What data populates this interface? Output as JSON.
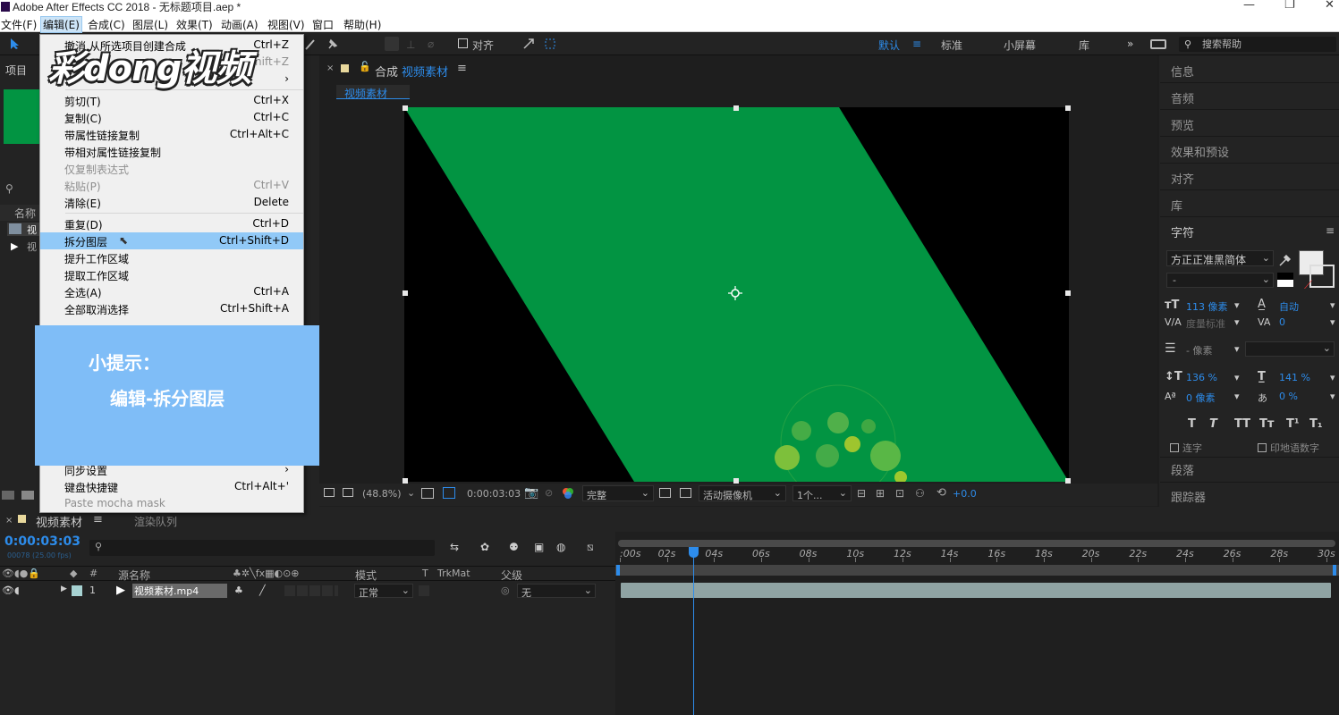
{
  "window": {
    "title": "Adobe After Effects CC 2018 - 无标题项目.aep *",
    "controls": [
      "—",
      "❐",
      "✕"
    ]
  },
  "menubar": [
    "文件(F)",
    "编辑(E)",
    "合成(C)",
    "图层(L)",
    "效果(T)",
    "动画(A)",
    "视图(V)",
    "窗口",
    "帮助(H)"
  ],
  "toolbar": {
    "align_label": "对齐",
    "workspaces": [
      "默认",
      "标准",
      "小屏幕",
      "库"
    ],
    "search_placeholder": "搜索帮助"
  },
  "watermark": "彩dong视频",
  "edit_menu": [
    {
      "label": "撤消 从所选项目创建合成",
      "shortcut": "Ctrl+Z",
      "disabled": false
    },
    {
      "label": "",
      "shortcut": "Shift+Z",
      "disabled": true
    },
    {
      "label": "",
      "shortcut": "›",
      "disabled": false
    },
    {
      "sep": true
    },
    {
      "label": "剪切(T)",
      "shortcut": "Ctrl+X",
      "disabled": false
    },
    {
      "label": "复制(C)",
      "shortcut": "Ctrl+C",
      "disabled": false
    },
    {
      "label": "带属性链接复制",
      "shortcut": "Ctrl+Alt+C",
      "disabled": false
    },
    {
      "label": "带相对属性链接复制",
      "shortcut": "",
      "disabled": false
    },
    {
      "label": "仅复制表达式",
      "shortcut": "",
      "disabled": true
    },
    {
      "label": "粘贴(P)",
      "shortcut": "Ctrl+V",
      "disabled": true
    },
    {
      "label": "清除(E)",
      "shortcut": "Delete",
      "disabled": false
    },
    {
      "sep": true
    },
    {
      "label": "重复(D)",
      "shortcut": "Ctrl+D",
      "disabled": false
    },
    {
      "label": "拆分图层",
      "shortcut": "Ctrl+Shift+D",
      "disabled": false,
      "highlight": true
    },
    {
      "label": "提升工作区域",
      "shortcut": "",
      "disabled": false
    },
    {
      "label": "提取工作区域",
      "shortcut": "",
      "disabled": false
    },
    {
      "label": "全选(A)",
      "shortcut": "Ctrl+A",
      "disabled": false
    },
    {
      "label": "全部取消选择",
      "shortcut": "Ctrl+Shift+A",
      "disabled": false
    }
  ],
  "edit_menu_bottom": [
    {
      "label": "同步设置",
      "shortcut": "›",
      "disabled": false
    },
    {
      "label": "键盘快捷键",
      "shortcut": "Ctrl+Alt+'",
      "disabled": false
    },
    {
      "label": "Paste mocha mask",
      "shortcut": "",
      "disabled": true
    }
  ],
  "tip": {
    "heading": "小提示：",
    "body": "编辑-拆分图层"
  },
  "project": {
    "tab": "项目",
    "name_col": "名称",
    "items": [
      "视",
      "视"
    ]
  },
  "composition": {
    "tab": "合成",
    "name": "视频素材",
    "flow_tab": "视频素材",
    "zoom": "(48.8%)",
    "timecode": "0:00:03:03",
    "quality": "完整",
    "camera": "活动摄像机",
    "views": "1个...",
    "exposure": "+0.0",
    "canvas_color": "#029442"
  },
  "right_panels": [
    "信息",
    "音频",
    "预览",
    "效果和预设",
    "对齐",
    "库",
    "字符",
    "段落",
    "跟踪器"
  ],
  "character": {
    "font": "方正正准黑简体",
    "style": "-",
    "size": "113 像素",
    "leading": "自动",
    "kerning": "度量标准",
    "tracking": "0",
    "stroke": "- 像素",
    "vscale": "136 %",
    "hscale": "141 %",
    "baseline": "0 像素",
    "tsume": "0 %",
    "type_buttons": [
      "T",
      "T",
      "TT",
      "Tт",
      "T¹",
      "T₁"
    ],
    "checks": [
      "连字",
      "印地语数字"
    ]
  },
  "timeline": {
    "tab": "视频素材",
    "render_tab": "渲染队列",
    "timecode": "0:00:03:03",
    "frame_info": "00078 (25.00 fps)",
    "cols": {
      "source": "源名称",
      "mode": "模式",
      "trkmat": "TrkMat",
      "parent": "父级"
    },
    "layer": {
      "num": "1",
      "name": "视频素材.mp4",
      "mode": "正常",
      "parent": "无"
    },
    "ruler": [
      ":00s",
      "02s",
      "04s",
      "06s",
      "08s",
      "10s",
      "12s",
      "14s",
      "16s",
      "18s",
      "20s",
      "22s",
      "24s",
      "26s",
      "28s",
      "30s"
    ],
    "playhead_seconds": 3.12
  }
}
